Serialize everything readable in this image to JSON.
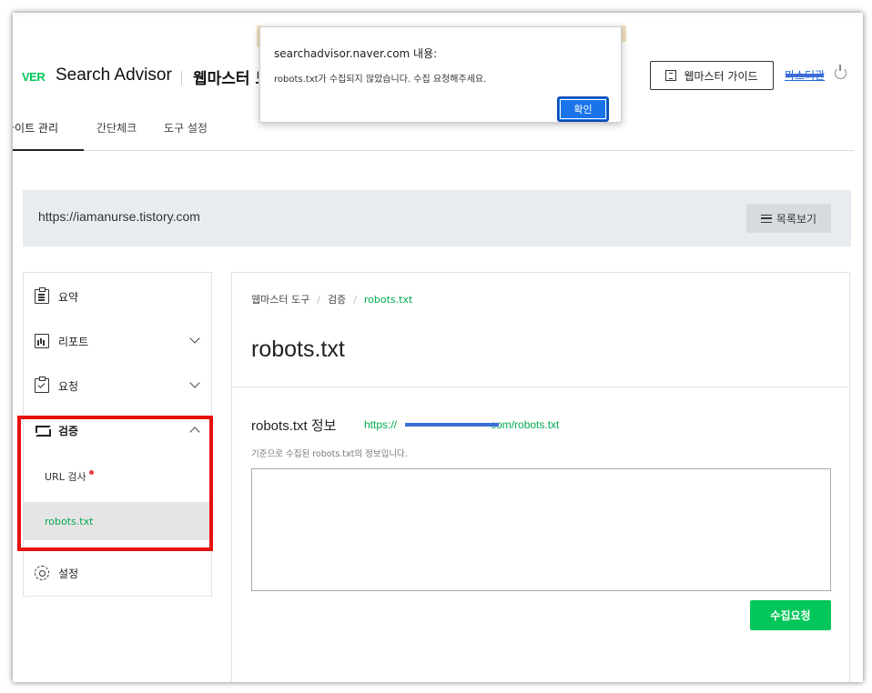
{
  "header": {
    "logo_text": "VER",
    "title": "Search Advisor",
    "subtitle": "웹마스터 도",
    "guide_button": "웹마스터 가이드",
    "user_name": "마스터관"
  },
  "tabs": [
    {
      "label": "사이트 관리"
    },
    {
      "label": "간단체크"
    },
    {
      "label": "도구 설정"
    }
  ],
  "site": {
    "url": "https://iamanurse.tistory.com",
    "list_button": "목록보기"
  },
  "sidebar": {
    "items": [
      {
        "label": "요약",
        "icon": "summary-icon"
      },
      {
        "label": "리포트",
        "icon": "report-icon"
      },
      {
        "label": "요청",
        "icon": "request-icon"
      },
      {
        "label": "검증",
        "icon": "verify-icon"
      },
      {
        "label": "설정",
        "icon": "settings-icon"
      }
    ],
    "sub_items": [
      {
        "label": "URL 검사"
      },
      {
        "label": "robots.txt"
      }
    ]
  },
  "main": {
    "breadcrumb": [
      "웹마스터 도구",
      "검증",
      "robots.txt"
    ],
    "title": "robots.txt",
    "section_title": "robots.txt 정보",
    "section_url_prefix": "https://",
    "section_url_suffix": "com/robots.txt",
    "description": "기준으로 수집된 robots.txt의 정보입니다.",
    "content": "",
    "collect_button": "수집요청"
  },
  "dialog": {
    "title": "searchadvisor.naver.com 내용:",
    "message": "robots.txt가 수집되지 않았습니다. 수집 요청해주세요.",
    "ok_button": "확인"
  },
  "colors": {
    "brand_green": "#03c75a",
    "link_green": "#03a94f",
    "highlight_red": "#e8110d",
    "dialog_blue": "#1a73e8"
  }
}
